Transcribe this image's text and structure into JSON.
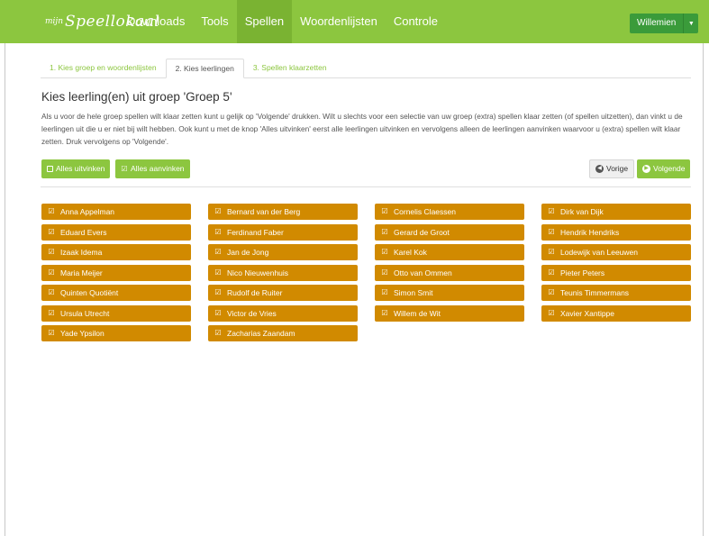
{
  "navbar": {
    "logo_mark": "mijn",
    "logo_text": "Speellokaal",
    "items": [
      {
        "label": "Downloads"
      },
      {
        "label": "Tools"
      },
      {
        "label": "Spellen"
      },
      {
        "label": "Woordenlijsten"
      },
      {
        "label": "Controle"
      }
    ],
    "active_item": "Spellen",
    "user_label": "Willemien",
    "user_caret_icon": "caret-down-icon"
  },
  "tabs": [
    {
      "label": "1. Kies groep en woordenlijsten"
    },
    {
      "label": "2. Kies leerlingen"
    },
    {
      "label": "3. Spellen klaarzetten"
    }
  ],
  "active_tab": "2. Kies leerlingen",
  "page_title": "Kies leerling(en) uit groep 'Groep 5'",
  "intro_text": "Als u voor de hele groep spellen wilt klaar zetten kunt u gelijk op 'Volgende' drukken. Wilt u slechts voor een selectie van uw groep (extra) spellen klaar zetten (of spellen uitzetten), dan vinkt u de leerlingen uit die u er niet bij wilt hebben. Ook kunt u met de knop 'Alles uitvinken' eerst alle leerlingen uitvinken en vervolgens alleen de leerlingen aanvinken waarvoor u (extra) spellen wilt klaar zetten. Druk vervolgens op 'Volgende'.",
  "buttons": {
    "uncheck_all": "Alles uitvinken",
    "check_all": "Alles aanvinken",
    "previous": "Vorige",
    "next": "Volgende"
  },
  "colors": {
    "brand_green": "#8cc63f",
    "student_orange": "#d18a00",
    "user_green": "#3a9b3a"
  },
  "students": [
    {
      "name": "Anna Appelman",
      "checked": true
    },
    {
      "name": "Bernard van der Berg",
      "checked": true
    },
    {
      "name": "Cornelis Claessen",
      "checked": true
    },
    {
      "name": "Dirk van Dijk",
      "checked": true
    },
    {
      "name": "Eduard Evers",
      "checked": true
    },
    {
      "name": "Ferdinand Faber",
      "checked": true
    },
    {
      "name": "Gerard de Groot",
      "checked": true
    },
    {
      "name": "Hendrik Hendriks",
      "checked": true
    },
    {
      "name": "Izaak Idema",
      "checked": true
    },
    {
      "name": "Jan de Jong",
      "checked": true
    },
    {
      "name": "Karel Kok",
      "checked": true
    },
    {
      "name": "Lodewijk van Leeuwen",
      "checked": true
    },
    {
      "name": "Maria Meijer",
      "checked": true
    },
    {
      "name": "Nico Nieuwenhuis",
      "checked": true
    },
    {
      "name": "Otto van Ommen",
      "checked": true
    },
    {
      "name": "Pieter Peters",
      "checked": true
    },
    {
      "name": "Quinten Quotiënt",
      "checked": true
    },
    {
      "name": "Rudolf de Ruiter",
      "checked": true
    },
    {
      "name": "Simon Smit",
      "checked": true
    },
    {
      "name": "Teunis Timmermans",
      "checked": true
    },
    {
      "name": "Ursula Utrecht",
      "checked": true
    },
    {
      "name": "Victor de Vries",
      "checked": true
    },
    {
      "name": "Willem de Wit",
      "checked": true
    },
    {
      "name": "Xavier Xantippe",
      "checked": true
    },
    {
      "name": "Yade Ypsilon",
      "checked": true
    },
    {
      "name": "Zacharias Zaandam",
      "checked": true
    }
  ]
}
